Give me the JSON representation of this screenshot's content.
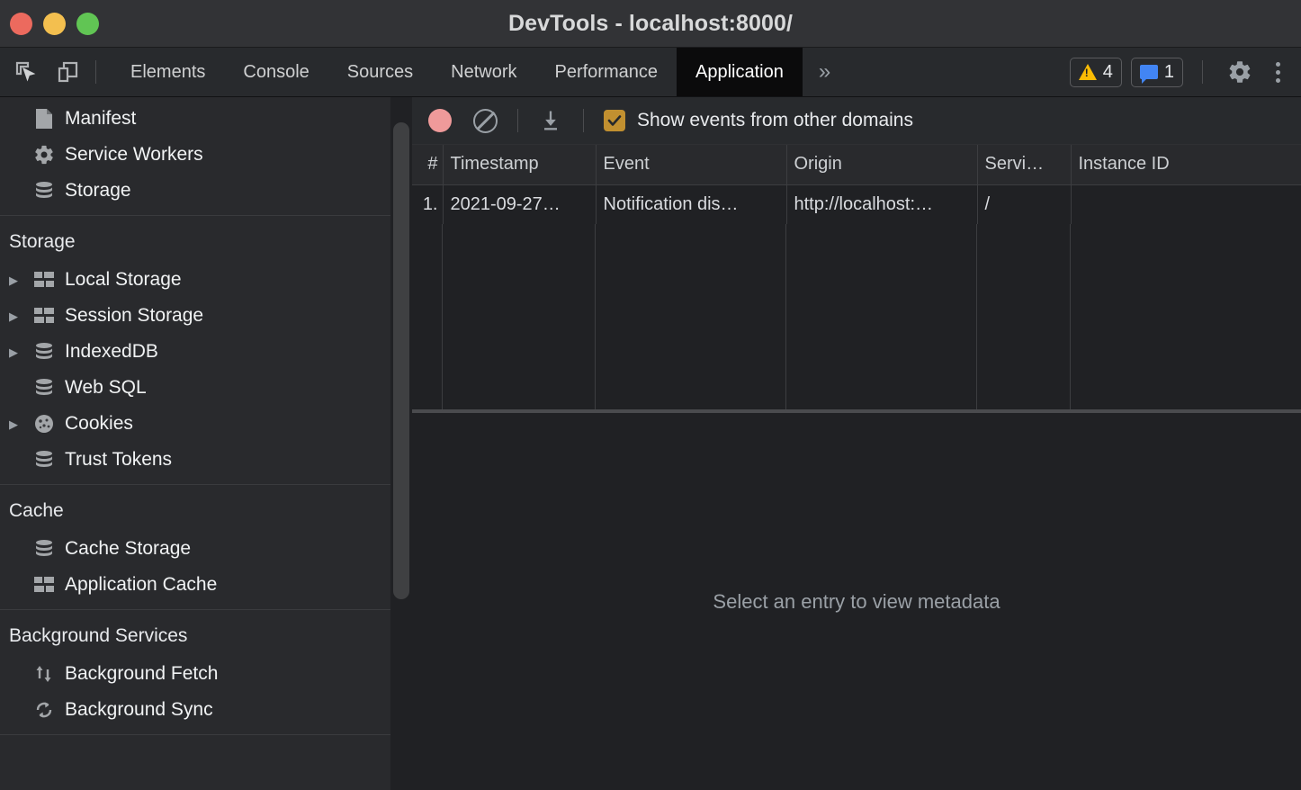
{
  "window": {
    "title": "DevTools - localhost:8000/",
    "traffic_lights": [
      "close",
      "minimize",
      "zoom"
    ],
    "colors": {
      "close": "#ec6a5e",
      "minimize": "#f3bf4f",
      "zoom": "#61c554"
    }
  },
  "toolbar": {
    "inspect_icon": "inspect-element-icon",
    "device_icon": "device-toolbar-icon",
    "tabs": [
      {
        "label": "Elements",
        "active": false
      },
      {
        "label": "Console",
        "active": false
      },
      {
        "label": "Sources",
        "active": false
      },
      {
        "label": "Network",
        "active": false
      },
      {
        "label": "Performance",
        "active": false
      },
      {
        "label": "Application",
        "active": true
      }
    ],
    "more_tabs": "»",
    "warnings_count": "4",
    "messages_count": "1",
    "settings_icon": "gear-icon",
    "more_options_icon": "kebab-menu-icon",
    "accent_warning": "#fbbc04",
    "accent_message": "#4285f4"
  },
  "sidebar": {
    "groups": [
      {
        "title": "",
        "items": [
          {
            "label": "Manifest",
            "icon": "document-icon",
            "expandable": false
          },
          {
            "label": "Service Workers",
            "icon": "gear-icon",
            "expandable": false
          },
          {
            "label": "Storage",
            "icon": "database-icon",
            "expandable": false
          }
        ]
      },
      {
        "title": "Storage",
        "items": [
          {
            "label": "Local Storage",
            "icon": "table-icon",
            "expandable": true
          },
          {
            "label": "Session Storage",
            "icon": "table-icon",
            "expandable": true
          },
          {
            "label": "IndexedDB",
            "icon": "database-icon",
            "expandable": true
          },
          {
            "label": "Web SQL",
            "icon": "database-icon",
            "expandable": false
          },
          {
            "label": "Cookies",
            "icon": "cookie-icon",
            "expandable": true
          },
          {
            "label": "Trust Tokens",
            "icon": "database-icon",
            "expandable": false
          }
        ]
      },
      {
        "title": "Cache",
        "items": [
          {
            "label": "Cache Storage",
            "icon": "database-icon",
            "expandable": false
          },
          {
            "label": "Application Cache",
            "icon": "table-icon",
            "expandable": false
          }
        ]
      },
      {
        "title": "Background Services",
        "items": [
          {
            "label": "Background Fetch",
            "icon": "updown-arrows-icon",
            "expandable": false
          },
          {
            "label": "Background Sync",
            "icon": "sync-icon",
            "expandable": false
          }
        ]
      }
    ]
  },
  "panel": {
    "record_button": "record-icon",
    "clear_button": "clear-icon",
    "export_button": "download-icon",
    "checkbox_checked": true,
    "checkbox_label": "Show events from other domains",
    "checkbox_color": "#c29030",
    "table": {
      "columns": [
        "#",
        "Timestamp",
        "Event",
        "Origin",
        "Servi…",
        "Instance ID"
      ],
      "rows": [
        {
          "num": "1.",
          "timestamp": "2021-09-27…",
          "event": "Notification dis…",
          "origin": "http://localhost:…",
          "service_worker": "/",
          "instance_id": ""
        }
      ]
    },
    "metadata_placeholder": "Select an entry to view metadata"
  }
}
